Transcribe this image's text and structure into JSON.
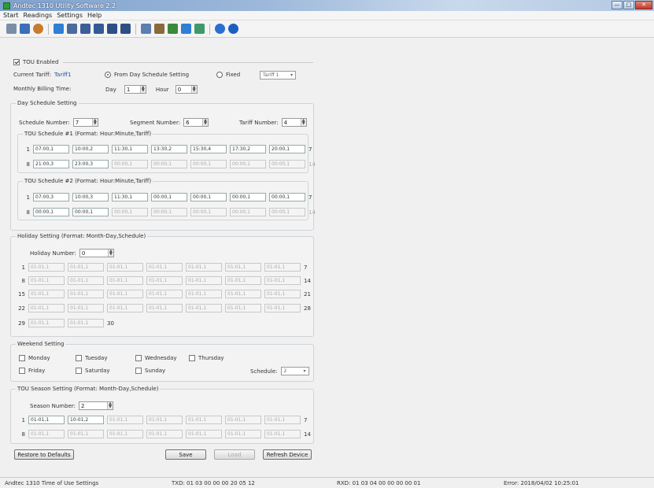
{
  "window": {
    "title": "Andtec 1310 Utility Software 2.2"
  },
  "menu": [
    "Start",
    "Readings",
    "Settings",
    "Help"
  ],
  "toolbar_icons": [
    "open-icon",
    "save-icon",
    "refresh-icon",
    "meter-icon",
    "print-icon",
    "chart-icon",
    "list-icon",
    "calendar-icon",
    "calendar2-icon",
    "file-icon",
    "tools-icon",
    "flag-icon",
    "export-icon",
    "report-icon",
    "help-icon",
    "info-icon"
  ],
  "tou": {
    "enable_label": "TOU Enabled",
    "current_tariff_label": "Current Tariff:",
    "current_tariff_value": "Tariff1",
    "radio_schedule": "From Day Schedule Setting",
    "radio_fixed": "Fixed",
    "fixed_select": "Tariff 1",
    "billing_label": "Monthly Billing Time:",
    "day_label": "Day",
    "day_value": "1",
    "hour_label": "Hour",
    "hour_value": "0"
  },
  "day_schedule": {
    "title": "Day Schedule Setting",
    "schedule_num_label": "Schedule Number:",
    "schedule_num": "7",
    "segment_num_label": "Segment Number:",
    "segment_num": "6",
    "tariff_num_label": "Tariff Number:",
    "tariff_num": "4",
    "sched1_title": "TOU Schedule #1 (Format: Hour:Minute,Tariff)",
    "sched1_row1": {
      "n": "1",
      "cells": [
        "07:00,1",
        "10:00,2",
        "11:30,1",
        "13:30,2",
        "15:30,4",
        "17:30,2",
        "20:00,1"
      ],
      "end": "7"
    },
    "sched1_row2": {
      "n": "8",
      "cells": [
        "21:00,3",
        "23:00,3",
        "00:00,1",
        "00:00,1",
        "00:00,1",
        "00:00,1",
        "00:00,1"
      ],
      "end": "14"
    },
    "sched2_title": "TOU Schedule #2 (Format: Hour:Minute,Tariff)",
    "sched2_row1": {
      "n": "1",
      "cells": [
        "07:00,3",
        "10:00,3",
        "11:30,1",
        "00:00,1",
        "00:00,1",
        "00:00,1",
        "00:00,1"
      ],
      "end": "7"
    },
    "sched2_row2": {
      "n": "8",
      "cells": [
        "00:00,1",
        "00:00,1",
        "00:00,1",
        "00:00,1",
        "00:00,1",
        "00:00,1",
        "00:00,1"
      ],
      "end": "14"
    }
  },
  "holiday": {
    "title": "Holiday Setting (Format: Month-Day,Schedule)",
    "number_label": "Holiday Number:",
    "number": "0",
    "rows": [
      {
        "n": "1",
        "cells": [
          "01-01,1",
          "01-01,1",
          "01-01,1",
          "01-01,1",
          "01-01,1",
          "01-01,1",
          "01-01,1"
        ],
        "end": "7"
      },
      {
        "n": "8",
        "cells": [
          "01-01,1",
          "01-01,1",
          "01-01,1",
          "01-01,1",
          "01-01,1",
          "01-01,1",
          "01-01,1"
        ],
        "end": "14"
      },
      {
        "n": "15",
        "cells": [
          "01-01,1",
          "01-01,1",
          "01-01,1",
          "01-01,1",
          "01-01,1",
          "01-01,1",
          "01-01,1"
        ],
        "end": "21"
      },
      {
        "n": "22",
        "cells": [
          "01-01,1",
          "01-01,1",
          "01-01,1",
          "01-01,1",
          "01-01,1",
          "01-01,1",
          "01-01,1"
        ],
        "end": "28"
      }
    ],
    "last": {
      "n": "29",
      "cells": [
        "01-01,1",
        "01-01,1"
      ],
      "end": "30"
    }
  },
  "weekend": {
    "title": "Weekend Setting",
    "days": [
      "Monday",
      "Tuesday",
      "Wednesday",
      "Thursday",
      "Friday",
      "Saturday",
      "Sunday"
    ],
    "schedule_label": "Schedule:",
    "schedule_value": "2"
  },
  "season": {
    "title": "TOU Season Setting (Format: Month-Day,Schedule)",
    "number_label": "Season Number:",
    "number": "2",
    "row1": {
      "n": "1",
      "cells": [
        "01-01,1",
        "10-01,2",
        "01-01,1",
        "01-01,1",
        "01-01,1",
        "01-01,1",
        "01-01,1"
      ],
      "end": "7"
    },
    "row2": {
      "n": "8",
      "cells": [
        "01-01,1",
        "01-01,1",
        "01-01,1",
        "01-01,1",
        "01-01,1",
        "01-01,1",
        "01-01,1"
      ],
      "end": "14"
    }
  },
  "buttons": {
    "restore": "Restore to Defaults",
    "save": "Save",
    "load": "Load",
    "refresh": "Refresh Device"
  },
  "status": {
    "left": "Andtec 1310 Time of Use Settings",
    "tx": "TXD: 01 03 00 00 00 20 05 12",
    "rx": "RXD: 01 03 04 00 00 00 00 01",
    "err": "Error: 2018/04/02 10:25:01"
  }
}
